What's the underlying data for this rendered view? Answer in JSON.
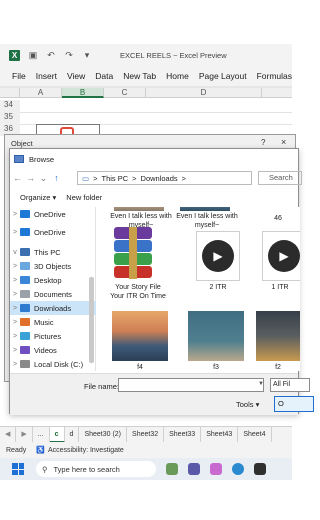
{
  "titlebar": {
    "title": "EXCEL REELS ~ Excel Preview"
  },
  "menu": [
    "File",
    "Insert",
    "View",
    "Data",
    "New Tab",
    "Home",
    "Page Layout",
    "Formulas"
  ],
  "grid": {
    "columns": [
      "A",
      "B",
      "C",
      "D"
    ],
    "selected_column": "B",
    "rows": [
      "34",
      "35",
      "36"
    ]
  },
  "object_dialog": {
    "title": "Object",
    "help": "?",
    "close": "×"
  },
  "browse": {
    "title": "Browse",
    "address": {
      "path": [
        "This PC",
        "Downloads"
      ],
      "sep": ">",
      "search_placeholder": "Search"
    },
    "toolbar": {
      "organize": "Organize ▾",
      "new_folder": "New folder"
    },
    "nav": [
      {
        "label": "OneDrive",
        "chev": ">",
        "color": "#1e78d6"
      },
      {
        "label": "OneDrive",
        "chev": ">",
        "color": "#1e78d6"
      },
      {
        "label": "This PC",
        "chev": "v",
        "color": "#3a6fb0"
      },
      {
        "label": "3D Objects",
        "chev": ">",
        "color": "#6aa6e0"
      },
      {
        "label": "Desktop",
        "chev": ">",
        "color": "#3c86d9"
      },
      {
        "label": "Documents",
        "chev": ">",
        "color": "#9aa1a8"
      },
      {
        "label": "Downloads",
        "chev": ">",
        "color": "#2f7bd0",
        "selected": true
      },
      {
        "label": "Music",
        "chev": ">",
        "color": "#e0702a"
      },
      {
        "label": "Pictures",
        "chev": ">",
        "color": "#3aa0d8"
      },
      {
        "label": "Videos",
        "chev": ">",
        "color": "#7050c0"
      },
      {
        "label": "Local Disk (C:)",
        "chev": ">",
        "color": "#8a8a8a"
      }
    ],
    "files": {
      "top_row": [
        "Even I talk less with myself~",
        "Even I talk less with myself~",
        "46"
      ],
      "mid_row": [
        "Your Story File Your ITR On Time",
        "2 ITR",
        "1 ITR"
      ],
      "bottom_row": [
        "f4",
        "f3",
        "f2"
      ]
    },
    "filename_label": "File name:",
    "filter_value": "All Fil",
    "tools": "Tools ▾",
    "open": "O"
  },
  "sheet_tabs": [
    "...",
    "c",
    "d",
    "Sheet30 (2)",
    "Sheet32",
    "Sheet33",
    "Sheet43",
    "Sheet4"
  ],
  "active_sheet": "c",
  "status": {
    "ready": "Ready",
    "accessibility": "Accessibility: Investigate"
  },
  "taskbar": {
    "search_placeholder": "Type here to search"
  }
}
